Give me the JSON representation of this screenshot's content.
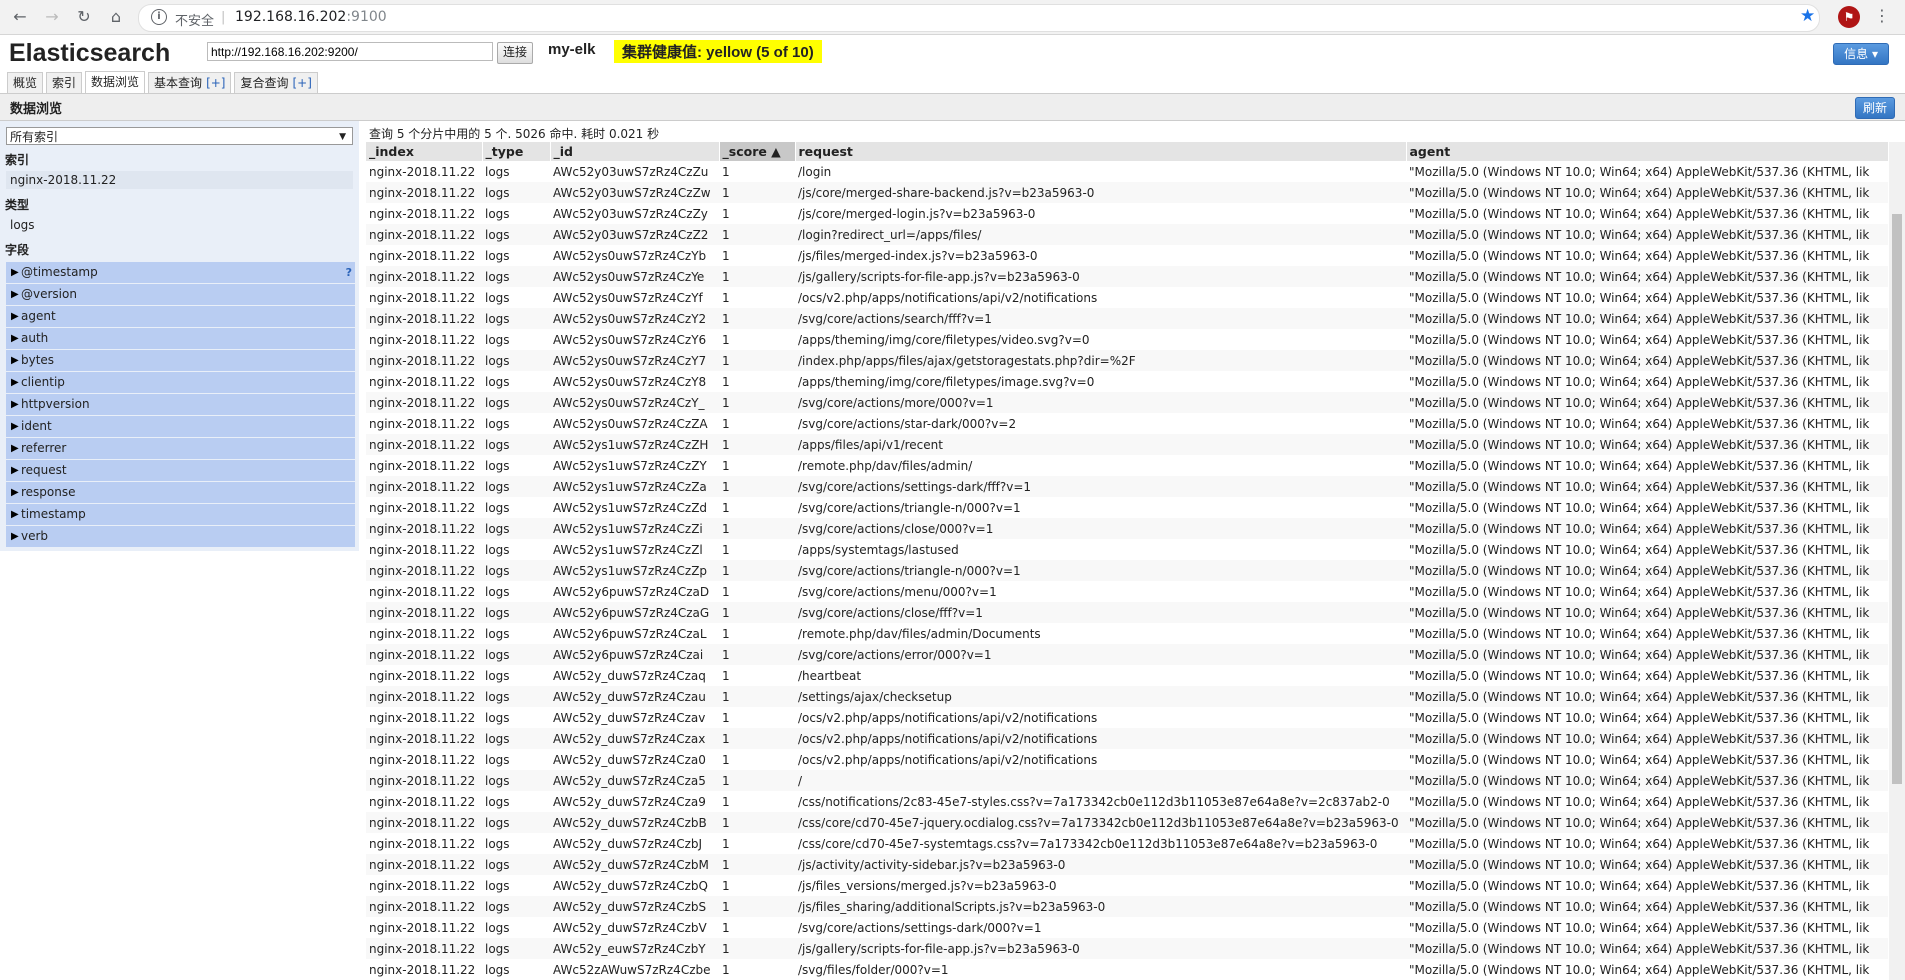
{
  "browser": {
    "security_label": "不安全",
    "url_host": "192.168.16.202",
    "url_port": ":9100"
  },
  "app": {
    "title": "Elasticsearch",
    "es_url": "http://192.168.16.202:9200/",
    "connect_label": "连接",
    "cluster_name": "my-elk",
    "health": "集群健康值: yellow (5 of 10)",
    "info_label": "信息 ▾",
    "tabs": [
      {
        "label": "概览",
        "plus": ""
      },
      {
        "label": "索引",
        "plus": ""
      },
      {
        "label": "数据浏览",
        "plus": ""
      },
      {
        "label": "基本查询",
        "plus": "[+]"
      },
      {
        "label": "复合查询",
        "plus": "[+]"
      }
    ],
    "page_title": "数据浏览",
    "refresh_label": "刷新"
  },
  "sidebar": {
    "index_select": "所有索引",
    "index_heading": "索引",
    "index_item": "nginx-2018.11.22",
    "type_heading": "类型",
    "type_item": "logs",
    "fields_heading": "字段",
    "fields": [
      "@timestamp",
      "@version",
      "agent",
      "auth",
      "bytes",
      "clientip",
      "httpversion",
      "ident",
      "referrer",
      "request",
      "response",
      "timestamp",
      "verb"
    ]
  },
  "results": {
    "query_info": "查询 5 个分片中用的 5 个. 5026 命中. 耗时 0.021 秒",
    "columns": [
      "_index",
      "_type",
      "_id",
      "_score ▲",
      "request",
      "agent"
    ],
    "agent_value": "\"Mozilla/5.0 (Windows NT 10.0; Win64; x64) AppleWebKit/537.36 (KHTML, lik",
    "rows": [
      [
        "nginx-2018.11.22",
        "logs",
        "AWc52y03uwS7zRz4CzZu",
        "1",
        "/login"
      ],
      [
        "nginx-2018.11.22",
        "logs",
        "AWc52y03uwS7zRz4CzZw",
        "1",
        "/js/core/merged-share-backend.js?v=b23a5963-0"
      ],
      [
        "nginx-2018.11.22",
        "logs",
        "AWc52y03uwS7zRz4CzZy",
        "1",
        "/js/core/merged-login.js?v=b23a5963-0"
      ],
      [
        "nginx-2018.11.22",
        "logs",
        "AWc52y03uwS7zRz4CzZ2",
        "1",
        "/login?redirect_url=/apps/files/"
      ],
      [
        "nginx-2018.11.22",
        "logs",
        "AWc52ys0uwS7zRz4CzYb",
        "1",
        "/js/files/merged-index.js?v=b23a5963-0"
      ],
      [
        "nginx-2018.11.22",
        "logs",
        "AWc52ys0uwS7zRz4CzYe",
        "1",
        "/js/gallery/scripts-for-file-app.js?v=b23a5963-0"
      ],
      [
        "nginx-2018.11.22",
        "logs",
        "AWc52ys0uwS7zRz4CzYf",
        "1",
        "/ocs/v2.php/apps/notifications/api/v2/notifications"
      ],
      [
        "nginx-2018.11.22",
        "logs",
        "AWc52ys0uwS7zRz4CzY2",
        "1",
        "/svg/core/actions/search/fff?v=1"
      ],
      [
        "nginx-2018.11.22",
        "logs",
        "AWc52ys0uwS7zRz4CzY6",
        "1",
        "/apps/theming/img/core/filetypes/video.svg?v=0"
      ],
      [
        "nginx-2018.11.22",
        "logs",
        "AWc52ys0uwS7zRz4CzY7",
        "1",
        "/index.php/apps/files/ajax/getstoragestats.php?dir=%2F"
      ],
      [
        "nginx-2018.11.22",
        "logs",
        "AWc52ys0uwS7zRz4CzY8",
        "1",
        "/apps/theming/img/core/filetypes/image.svg?v=0"
      ],
      [
        "nginx-2018.11.22",
        "logs",
        "AWc52ys0uwS7zRz4CzY_",
        "1",
        "/svg/core/actions/more/000?v=1"
      ],
      [
        "nginx-2018.11.22",
        "logs",
        "AWc52ys0uwS7zRz4CzZA",
        "1",
        "/svg/core/actions/star-dark/000?v=2"
      ],
      [
        "nginx-2018.11.22",
        "logs",
        "AWc52ys1uwS7zRz4CzZH",
        "1",
        "/apps/files/api/v1/recent"
      ],
      [
        "nginx-2018.11.22",
        "logs",
        "AWc52ys1uwS7zRz4CzZY",
        "1",
        "/remote.php/dav/files/admin/"
      ],
      [
        "nginx-2018.11.22",
        "logs",
        "AWc52ys1uwS7zRz4CzZa",
        "1",
        "/svg/core/actions/settings-dark/fff?v=1"
      ],
      [
        "nginx-2018.11.22",
        "logs",
        "AWc52ys1uwS7zRz4CzZd",
        "1",
        "/svg/core/actions/triangle-n/000?v=1"
      ],
      [
        "nginx-2018.11.22",
        "logs",
        "AWc52ys1uwS7zRz4CzZi",
        "1",
        "/svg/core/actions/close/000?v=1"
      ],
      [
        "nginx-2018.11.22",
        "logs",
        "AWc52ys1uwS7zRz4CzZl",
        "1",
        "/apps/systemtags/lastused"
      ],
      [
        "nginx-2018.11.22",
        "logs",
        "AWc52ys1uwS7zRz4CzZp",
        "1",
        "/svg/core/actions/triangle-n/000?v=1"
      ],
      [
        "nginx-2018.11.22",
        "logs",
        "AWc52y6puwS7zRz4CzaD",
        "1",
        "/svg/core/actions/menu/000?v=1"
      ],
      [
        "nginx-2018.11.22",
        "logs",
        "AWc52y6puwS7zRz4CzaG",
        "1",
        "/svg/core/actions/close/fff?v=1"
      ],
      [
        "nginx-2018.11.22",
        "logs",
        "AWc52y6puwS7zRz4CzaL",
        "1",
        "/remote.php/dav/files/admin/Documents"
      ],
      [
        "nginx-2018.11.22",
        "logs",
        "AWc52y6puwS7zRz4Czai",
        "1",
        "/svg/core/actions/error/000?v=1"
      ],
      [
        "nginx-2018.11.22",
        "logs",
        "AWc52y_duwS7zRz4Czaq",
        "1",
        "/heartbeat"
      ],
      [
        "nginx-2018.11.22",
        "logs",
        "AWc52y_duwS7zRz4Czau",
        "1",
        "/settings/ajax/checksetup"
      ],
      [
        "nginx-2018.11.22",
        "logs",
        "AWc52y_duwS7zRz4Czav",
        "1",
        "/ocs/v2.php/apps/notifications/api/v2/notifications"
      ],
      [
        "nginx-2018.11.22",
        "logs",
        "AWc52y_duwS7zRz4Czax",
        "1",
        "/ocs/v2.php/apps/notifications/api/v2/notifications"
      ],
      [
        "nginx-2018.11.22",
        "logs",
        "AWc52y_duwS7zRz4Cza0",
        "1",
        "/ocs/v2.php/apps/notifications/api/v2/notifications"
      ],
      [
        "nginx-2018.11.22",
        "logs",
        "AWc52y_duwS7zRz4Cza5",
        "1",
        "/"
      ],
      [
        "nginx-2018.11.22",
        "logs",
        "AWc52y_duwS7zRz4Cza9",
        "1",
        "/css/notifications/2c83-45e7-styles.css?v=7a173342cb0e112d3b11053e87e64a8e?v=2c837ab2-0"
      ],
      [
        "nginx-2018.11.22",
        "logs",
        "AWc52y_duwS7zRz4CzbB",
        "1",
        "/css/core/cd70-45e7-jquery.ocdialog.css?v=7a173342cb0e112d3b11053e87e64a8e?v=b23a5963-0"
      ],
      [
        "nginx-2018.11.22",
        "logs",
        "AWc52y_duwS7zRz4CzbJ",
        "1",
        "/css/core/cd70-45e7-systemtags.css?v=7a173342cb0e112d3b11053e87e64a8e?v=b23a5963-0"
      ],
      [
        "nginx-2018.11.22",
        "logs",
        "AWc52y_duwS7zRz4CzbM",
        "1",
        "/js/activity/activity-sidebar.js?v=b23a5963-0"
      ],
      [
        "nginx-2018.11.22",
        "logs",
        "AWc52y_duwS7zRz4CzbQ",
        "1",
        "/js/files_versions/merged.js?v=b23a5963-0"
      ],
      [
        "nginx-2018.11.22",
        "logs",
        "AWc52y_duwS7zRz4CzbS",
        "1",
        "/js/files_sharing/additionalScripts.js?v=b23a5963-0"
      ],
      [
        "nginx-2018.11.22",
        "logs",
        "AWc52y_duwS7zRz4CzbV",
        "1",
        "/svg/core/actions/settings-dark/000?v=1"
      ],
      [
        "nginx-2018.11.22",
        "logs",
        "AWc52y_euwS7zRz4CzbY",
        "1",
        "/js/gallery/scripts-for-file-app.js?v=b23a5963-0"
      ],
      [
        "nginx-2018.11.22",
        "logs",
        "AWc52zAWuwS7zRz4Czbe",
        "1",
        "/svg/files/folder/000?v=1"
      ]
    ]
  }
}
